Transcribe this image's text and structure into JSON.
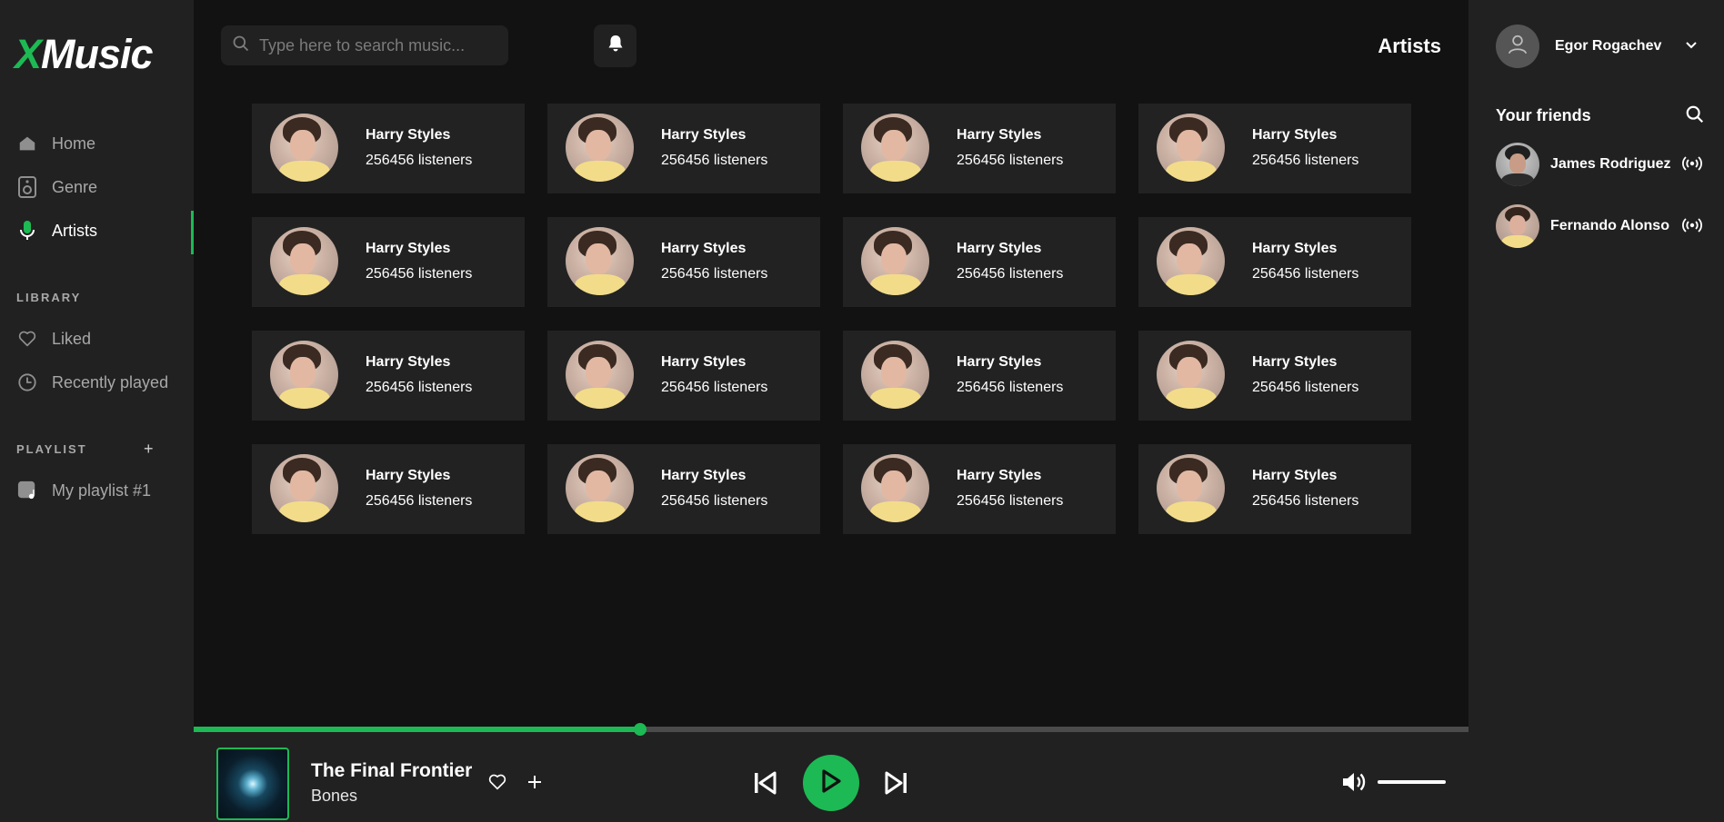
{
  "app": {
    "logo_x": "X",
    "logo_rest": "Music"
  },
  "sidebar": {
    "items": [
      {
        "label": "Home",
        "icon": "home-icon",
        "active": false
      },
      {
        "label": "Genre",
        "icon": "speaker-icon",
        "active": false
      },
      {
        "label": "Artists",
        "icon": "microphone-icon",
        "active": true
      }
    ],
    "library_title": "LIBRARY",
    "library_items": [
      {
        "label": "Liked",
        "icon": "heart-icon"
      },
      {
        "label": "Recently played",
        "icon": "clock-icon"
      }
    ],
    "playlist_title": "PLAYLIST",
    "playlist_add": "+",
    "playlists": [
      {
        "label": "My playlist #1",
        "icon": "playlist-icon"
      }
    ]
  },
  "header": {
    "search_placeholder": "Type here to search music...",
    "search_value": "",
    "page_title": "Artists"
  },
  "artists": [
    {
      "name": "Harry Styles",
      "listeners": "256456 listeners"
    },
    {
      "name": "Harry Styles",
      "listeners": "256456 listeners"
    },
    {
      "name": "Harry Styles",
      "listeners": "256456 listeners"
    },
    {
      "name": "Harry Styles",
      "listeners": "256456 listeners"
    },
    {
      "name": "Harry Styles",
      "listeners": "256456 listeners"
    },
    {
      "name": "Harry Styles",
      "listeners": "256456 listeners"
    },
    {
      "name": "Harry Styles",
      "listeners": "256456 listeners"
    },
    {
      "name": "Harry Styles",
      "listeners": "256456 listeners"
    },
    {
      "name": "Harry Styles",
      "listeners": "256456 listeners"
    },
    {
      "name": "Harry Styles",
      "listeners": "256456 listeners"
    },
    {
      "name": "Harry Styles",
      "listeners": "256456 listeners"
    },
    {
      "name": "Harry Styles",
      "listeners": "256456 listeners"
    },
    {
      "name": "Harry Styles",
      "listeners": "256456 listeners"
    },
    {
      "name": "Harry Styles",
      "listeners": "256456 listeners"
    },
    {
      "name": "Harry Styles",
      "listeners": "256456 listeners"
    },
    {
      "name": "Harry Styles",
      "listeners": "256456 listeners"
    }
  ],
  "user": {
    "name": "Egor Rogachev"
  },
  "friends": {
    "title": "Your friends",
    "list": [
      {
        "name": "James Rodriguez",
        "status_icon": "broadcast-icon"
      },
      {
        "name": "Fernando Alonso",
        "status_icon": "broadcast-icon"
      }
    ]
  },
  "player": {
    "title": "The Final Frontier",
    "artist": "Bones",
    "progress": 0.35,
    "volume": 1.0
  },
  "colors": {
    "accent": "#1db954",
    "background": "#121212",
    "panel": "#212121",
    "card": "#222222"
  }
}
